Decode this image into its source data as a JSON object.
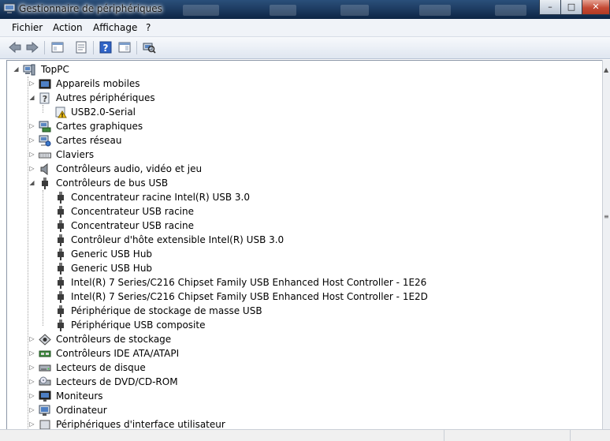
{
  "window": {
    "title": "Gestionnaire de périphériques",
    "controls": {
      "minimize": "–",
      "maximize": "□",
      "close": "✕"
    }
  },
  "menu": [
    "Fichier",
    "Action",
    "Affichage",
    "?"
  ],
  "toolbar": {
    "buttons": [
      "back-arrow-icon",
      "forward-arrow-icon",
      "show-hide-tree-icon",
      "properties-icon",
      "help-icon",
      "action-pane-icon",
      "scan-hardware-icon"
    ]
  },
  "tree": {
    "root": "TopPC",
    "categories": [
      {
        "label": "Appareils mobiles",
        "icon": "mobile-device-icon",
        "expanded": false
      },
      {
        "label": "Autres périphériques",
        "icon": "unknown-device-icon",
        "expanded": true,
        "children": [
          {
            "label": "USB2.0-Serial",
            "icon": "warning-device-icon"
          }
        ]
      },
      {
        "label": "Cartes graphiques",
        "icon": "display-adapter-icon",
        "expanded": false
      },
      {
        "label": "Cartes réseau",
        "icon": "network-adapter-icon",
        "expanded": false
      },
      {
        "label": "Claviers",
        "icon": "keyboard-icon",
        "expanded": false
      },
      {
        "label": "Contrôleurs audio, vidéo et jeu",
        "icon": "speaker-icon",
        "expanded": false
      },
      {
        "label": "Contrôleurs de bus USB",
        "icon": "usb-plug-icon",
        "expanded": true,
        "children": [
          {
            "label": "Concentrateur racine Intel(R) USB 3.0",
            "icon": "usb-plug-icon"
          },
          {
            "label": "Concentrateur USB racine",
            "icon": "usb-plug-icon"
          },
          {
            "label": "Concentrateur USB racine",
            "icon": "usb-plug-icon"
          },
          {
            "label": "Contrôleur d'hôte extensible Intel(R) USB 3.0",
            "icon": "usb-plug-icon"
          },
          {
            "label": "Generic USB Hub",
            "icon": "usb-plug-icon"
          },
          {
            "label": "Generic USB Hub",
            "icon": "usb-plug-icon"
          },
          {
            "label": "Intel(R) 7 Series/C216 Chipset Family USB Enhanced Host Controller - 1E26",
            "icon": "usb-plug-icon"
          },
          {
            "label": "Intel(R) 7 Series/C216 Chipset Family USB Enhanced Host Controller - 1E2D",
            "icon": "usb-plug-icon"
          },
          {
            "label": "Périphérique de stockage de masse USB",
            "icon": "usb-plug-icon"
          },
          {
            "label": "Périphérique USB composite",
            "icon": "usb-plug-icon"
          }
        ]
      },
      {
        "label": "Contrôleurs de stockage",
        "icon": "storage-controller-icon",
        "expanded": false
      },
      {
        "label": "Contrôleurs IDE ATA/ATAPI",
        "icon": "ide-controller-icon",
        "expanded": false
      },
      {
        "label": "Lecteurs de disque",
        "icon": "disk-drive-icon",
        "expanded": false
      },
      {
        "label": "Lecteurs de DVD/CD-ROM",
        "icon": "dvd-drive-icon",
        "expanded": false
      },
      {
        "label": "Moniteurs",
        "icon": "monitor-icon",
        "expanded": false
      },
      {
        "label": "Ordinateur",
        "icon": "computer-icon",
        "expanded": false
      },
      {
        "label": "Périphériques d'interface utilisateur",
        "icon": "hid-icon",
        "expanded": false
      }
    ]
  },
  "colors": {
    "titlebar": "#1e3d63",
    "menubar": "#f0f3f8",
    "toolbar": "#e6ecf4",
    "warning": "#f2c21a"
  }
}
